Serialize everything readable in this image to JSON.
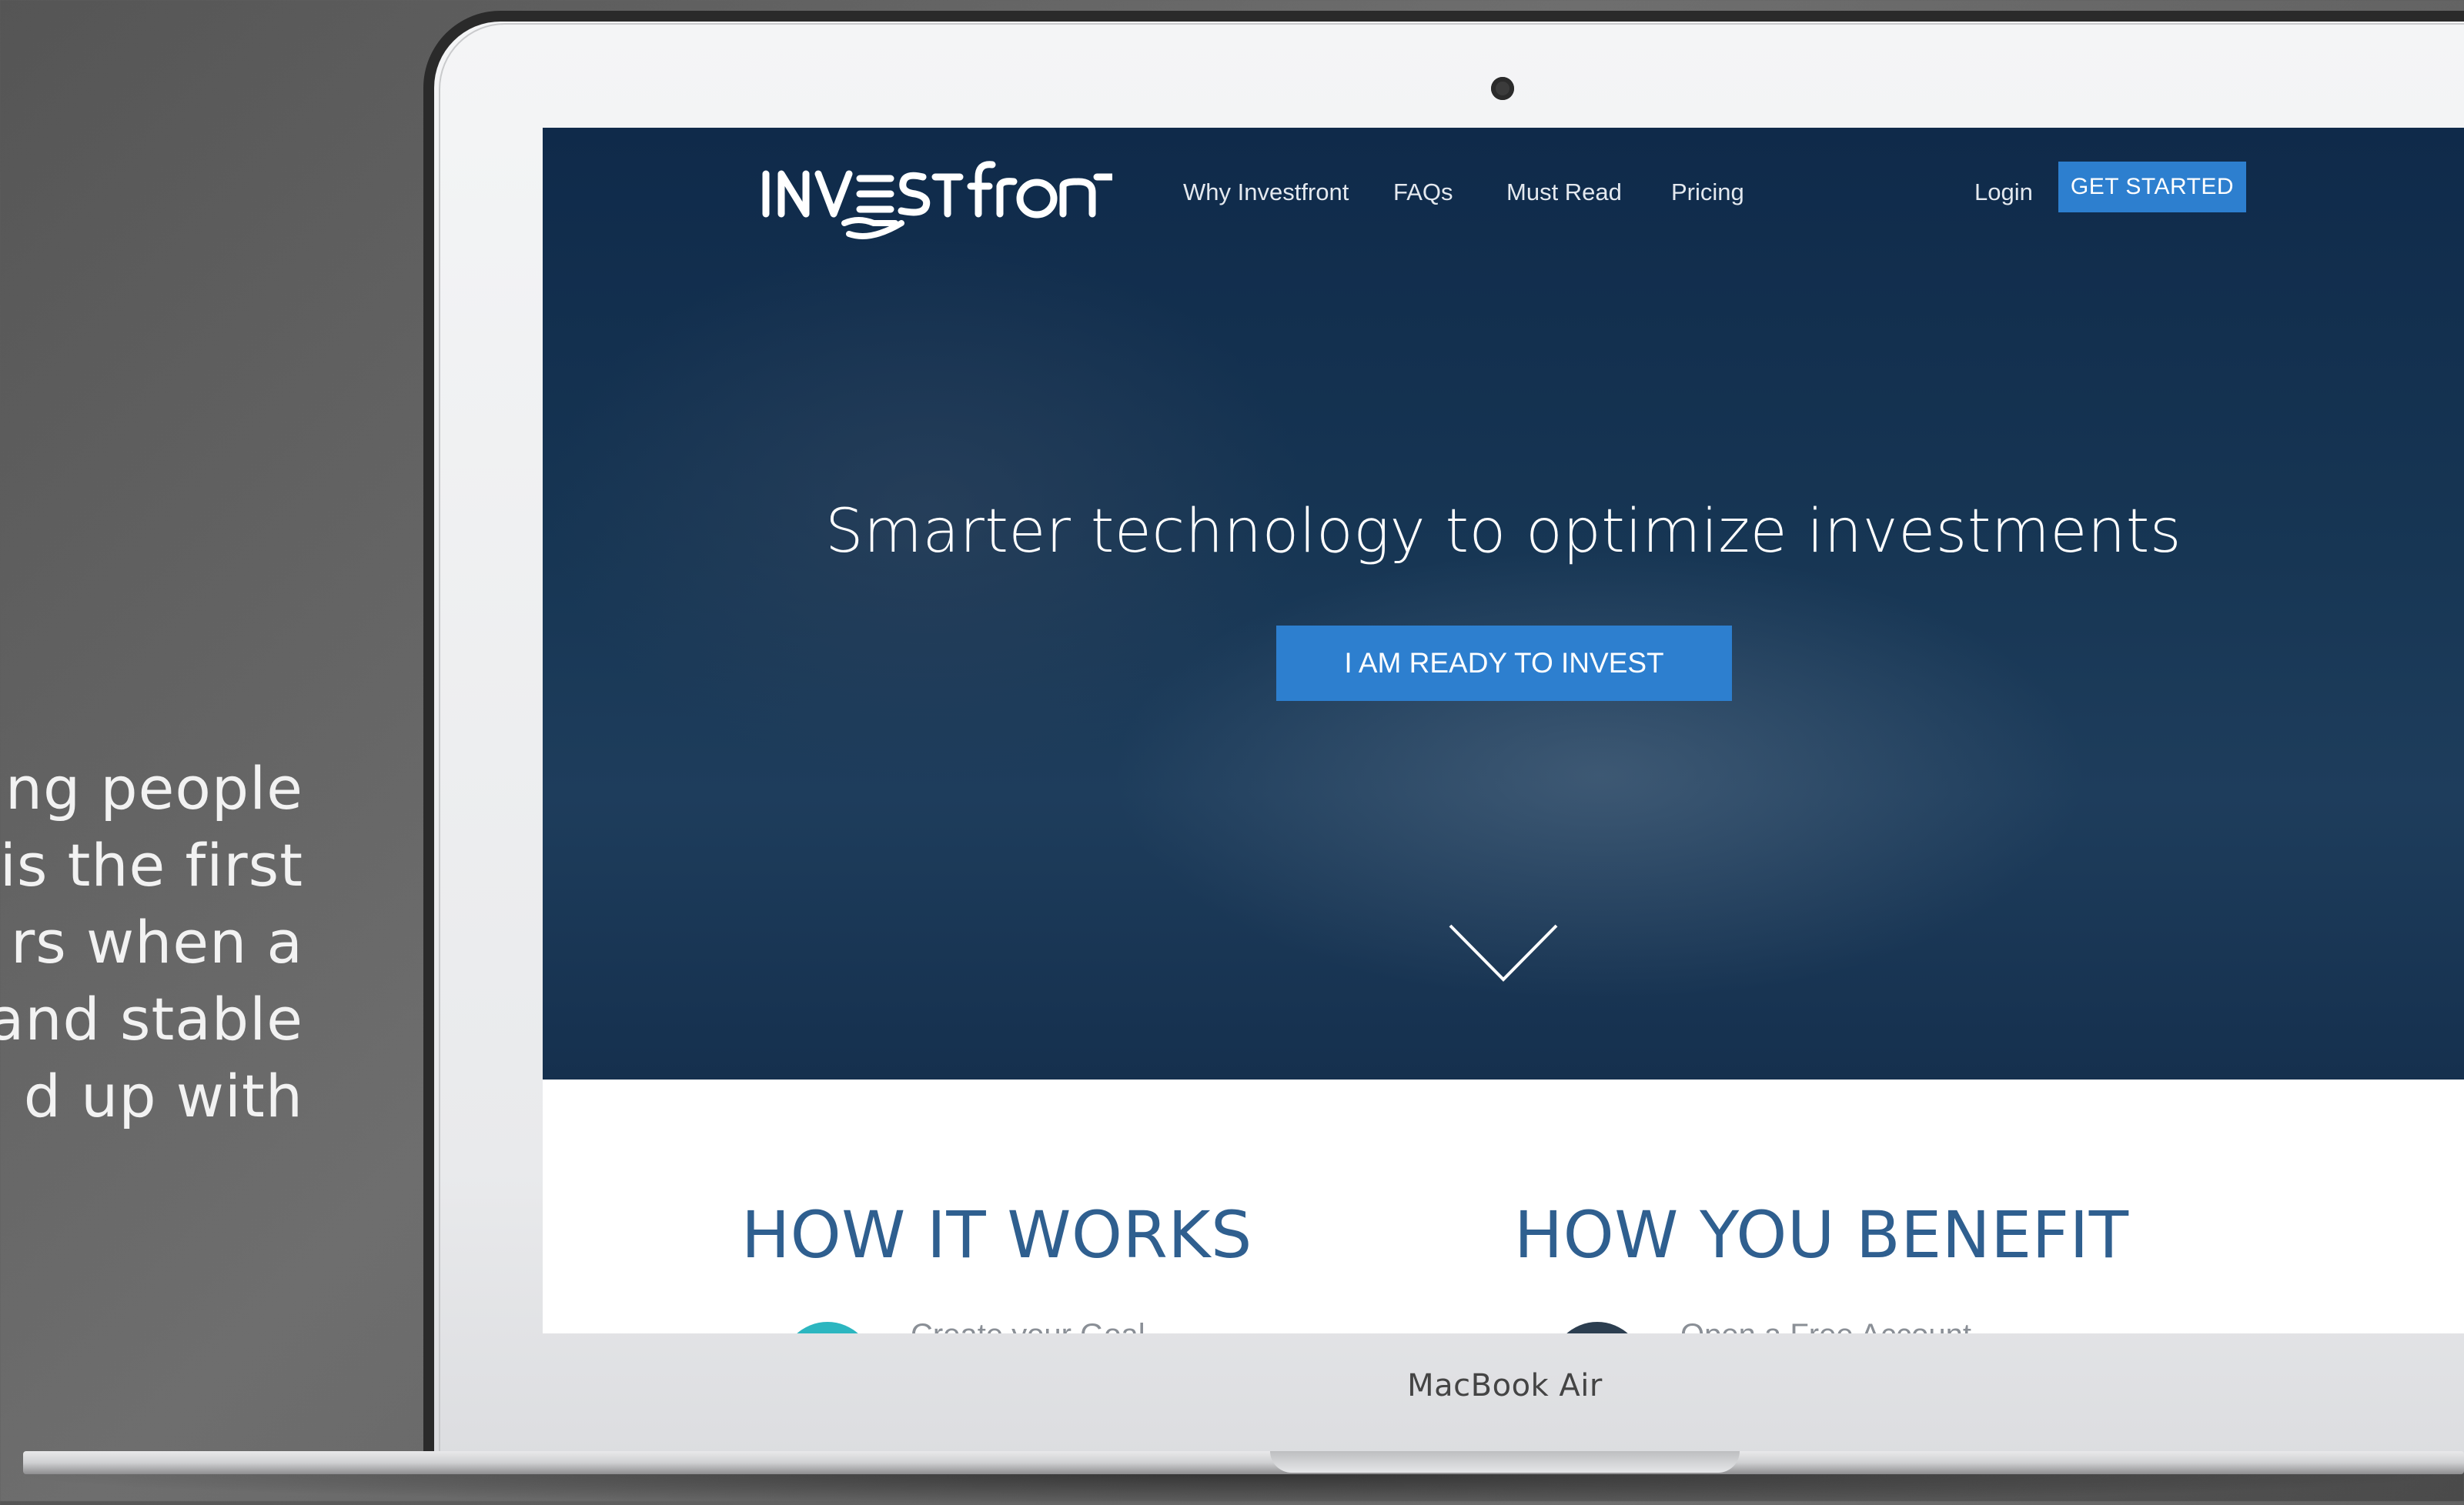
{
  "side_text": {
    "lines": [
      "ing people",
      "s is the first",
      "rs  when  a",
      "and  stable",
      "d  up  with"
    ]
  },
  "laptop": {
    "brand_label": "MacBook Air"
  },
  "site": {
    "logo_text": "INVESTFRONT",
    "nav": {
      "links": [
        "Why Investfront",
        "FAQs",
        "Must Read",
        "Pricing"
      ],
      "login": "Login",
      "get_started": "GET STARTED"
    },
    "hero": {
      "headline": "Smarter technology to optimize investments",
      "cta": "I AM READY TO INVEST",
      "scroll_icon": "chevron-down-icon"
    },
    "sections": {
      "how_it_works": {
        "title": "HOW IT WORKS",
        "first_step_partial": "Create your Goal"
      },
      "how_you_benefit": {
        "title": "HOW YOU BENEFIT",
        "first_item_partial": "Open a Free Account"
      }
    },
    "colors": {
      "hero_bg": "#173654",
      "accent_button": "#2d7fcf",
      "section_title": "#2f5f8f",
      "teal_circle": "#2cb6c0",
      "navy_circle": "#2c3e50"
    }
  }
}
